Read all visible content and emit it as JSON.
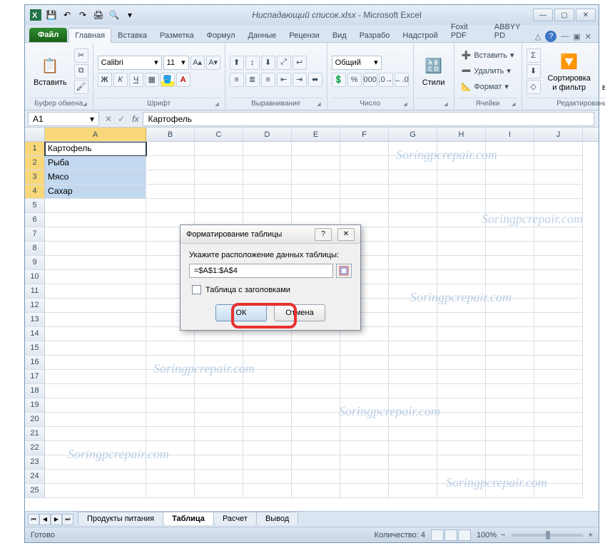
{
  "title": {
    "file": "Ниспадающий список.xlsx",
    "app": "Microsoft Excel"
  },
  "qat": [
    "excel-icon",
    "save-icon",
    "undo-icon",
    "redo-icon",
    "print-icon",
    "preview-icon",
    "dropdown-icon"
  ],
  "tabs": {
    "file": "Файл",
    "items": [
      "Главная",
      "Вставка",
      "Разметка",
      "Формул",
      "Данные",
      "Рецензи",
      "Вид",
      "Разрабо",
      "Надстрой",
      "Foxit PDF",
      "ABBYY PD"
    ],
    "active": 0
  },
  "ribbon": {
    "clipboard": {
      "label": "Буфер обмена",
      "paste": "Вставить"
    },
    "font": {
      "label": "Шрифт",
      "name": "Calibri",
      "size": "11"
    },
    "alignment": {
      "label": "Выравнивание"
    },
    "number": {
      "label": "Число",
      "format": "Общий"
    },
    "styles": {
      "label": "Стили",
      "btn": "Стили"
    },
    "cells": {
      "label": "Ячейки",
      "insert": "Вставить",
      "delete": "Удалить",
      "format": "Формат"
    },
    "editing": {
      "label": "Редактирование",
      "sort": "Сортировка и фильтр",
      "find": "Найти и выделить"
    }
  },
  "namebox": "A1",
  "formula": "Картофель",
  "columns": [
    "A",
    "B",
    "C",
    "D",
    "E",
    "F",
    "G",
    "H",
    "I",
    "J"
  ],
  "data": {
    "r1": "Картофель",
    "r2": "Рыба",
    "r3": "Мясо",
    "r4": "Сахар"
  },
  "selected_rows": 4,
  "sheets": {
    "items": [
      "Продукты питания",
      "Таблица",
      "Расчет",
      "Вывод"
    ],
    "active": 1
  },
  "status": {
    "ready": "Готово",
    "count_label": "Количество:",
    "count": "4",
    "zoom": "100%"
  },
  "dialog": {
    "title": "Форматирование таблицы",
    "prompt": "Укажите расположение данных таблицы:",
    "range": "=$A$1:$A$4",
    "headers": "Таблица с заголовками",
    "ok": "ОК",
    "cancel": "Отмена"
  },
  "watermark": "Soringpcrepair.com"
}
